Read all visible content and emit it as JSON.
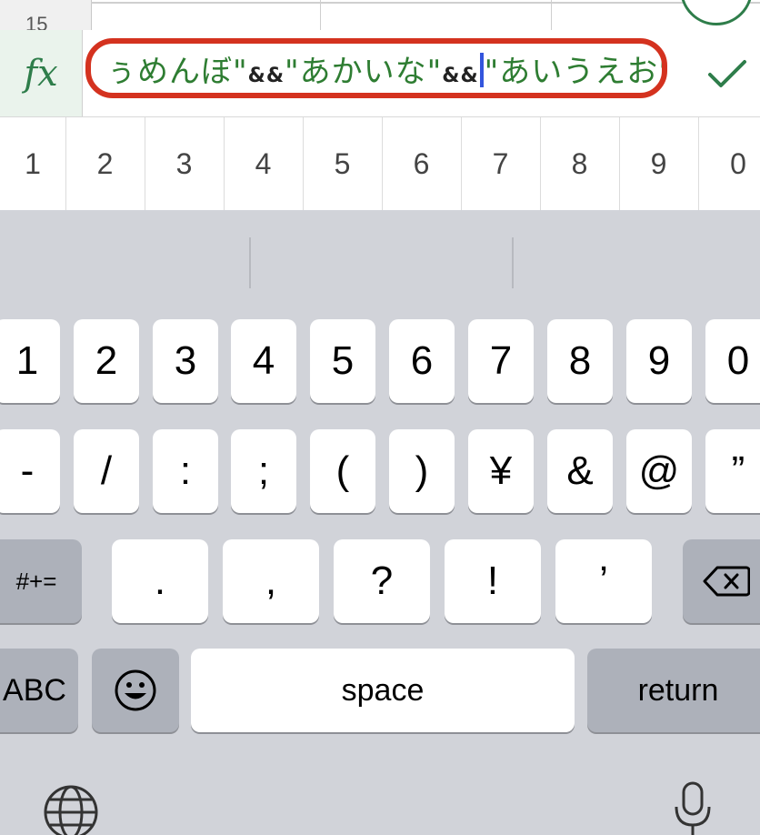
{
  "sheet": {
    "row_number": "15"
  },
  "formula_bar": {
    "fx_label": "fx",
    "segment1": "ぅめんぼ\"",
    "op1": "&&",
    "segment2": "\"あかいな\"",
    "op2": "&&",
    "segment3": "\"あいうえお\""
  },
  "suggestions": [
    "1",
    "2",
    "3",
    "4",
    "5",
    "6",
    "7",
    "8",
    "9",
    "0"
  ],
  "keyboard": {
    "row1": [
      "1",
      "2",
      "3",
      "4",
      "5",
      "6",
      "7",
      "8",
      "9",
      "0"
    ],
    "row2": [
      "-",
      "/",
      ":",
      ";",
      "(",
      ")",
      "¥",
      "&",
      "@",
      "”"
    ],
    "row3_mode": "#+=",
    "row3": [
      ".",
      ",",
      "?",
      "!",
      "’"
    ],
    "abc": "ABC",
    "space": "space",
    "return": "return"
  },
  "colors": {
    "accent_green": "#2e7d4a",
    "highlight_red": "#d4321f",
    "cursor_blue": "#3355dd"
  },
  "icons": [
    "check-icon",
    "backspace-icon",
    "emoji-icon",
    "globe-icon",
    "microphone-icon"
  ]
}
